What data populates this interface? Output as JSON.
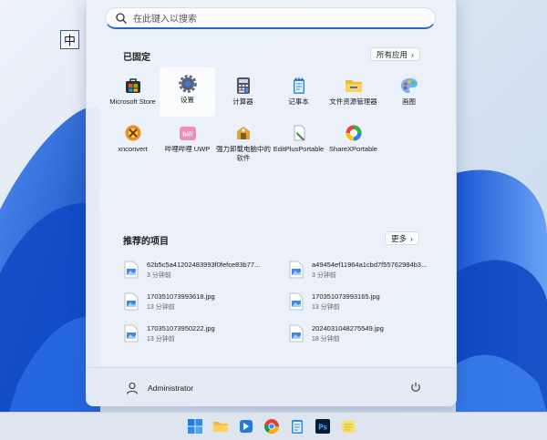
{
  "ime": {
    "label": "中"
  },
  "search": {
    "placeholder": "在此键入以搜索"
  },
  "pinned": {
    "title": "已固定",
    "all_apps_label": "所有应用",
    "apps": [
      {
        "label": "Microsoft Store",
        "icon": "store-icon"
      },
      {
        "label": "设置",
        "icon": "gear-icon"
      },
      {
        "label": "计算器",
        "icon": "calculator-icon"
      },
      {
        "label": "记事本",
        "icon": "notepad-icon"
      },
      {
        "label": "文件资源管理器",
        "icon": "folder-icon"
      },
      {
        "label": "画图",
        "icon": "paint-icon"
      },
      {
        "label": "xnconvert",
        "icon": "xnconvert-icon"
      },
      {
        "label": "哔哩哔哩 UWP",
        "icon": "bilibili-icon"
      },
      {
        "label": "强力卸载电脑中的软件",
        "icon": "uninstall-icon"
      },
      {
        "label": "EditPlusPortable",
        "icon": "editplus-icon"
      },
      {
        "label": "ShareXPortable",
        "icon": "sharex-icon"
      }
    ]
  },
  "recommended": {
    "title": "推荐的项目",
    "more_label": "更多",
    "items": [
      {
        "name": "62b5c5a41202483993f0fefce83b77...",
        "time": "3 分钟前"
      },
      {
        "name": "a49454ef11964a1cbd7f55762984b3...",
        "time": "3 分钟前"
      },
      {
        "name": "170351073993618.jpg",
        "time": "13 分钟前"
      },
      {
        "name": "170351073993165.jpg",
        "time": "13 分钟前"
      },
      {
        "name": "170351073950222.jpg",
        "time": "13 分钟前"
      },
      {
        "name": "2024031048275549.jpg",
        "time": "18 分钟前"
      }
    ]
  },
  "user": {
    "name": "Administrator"
  },
  "colors": {
    "accent": "#2a62c9",
    "wallpaper_blue": "#1f5fd8"
  }
}
